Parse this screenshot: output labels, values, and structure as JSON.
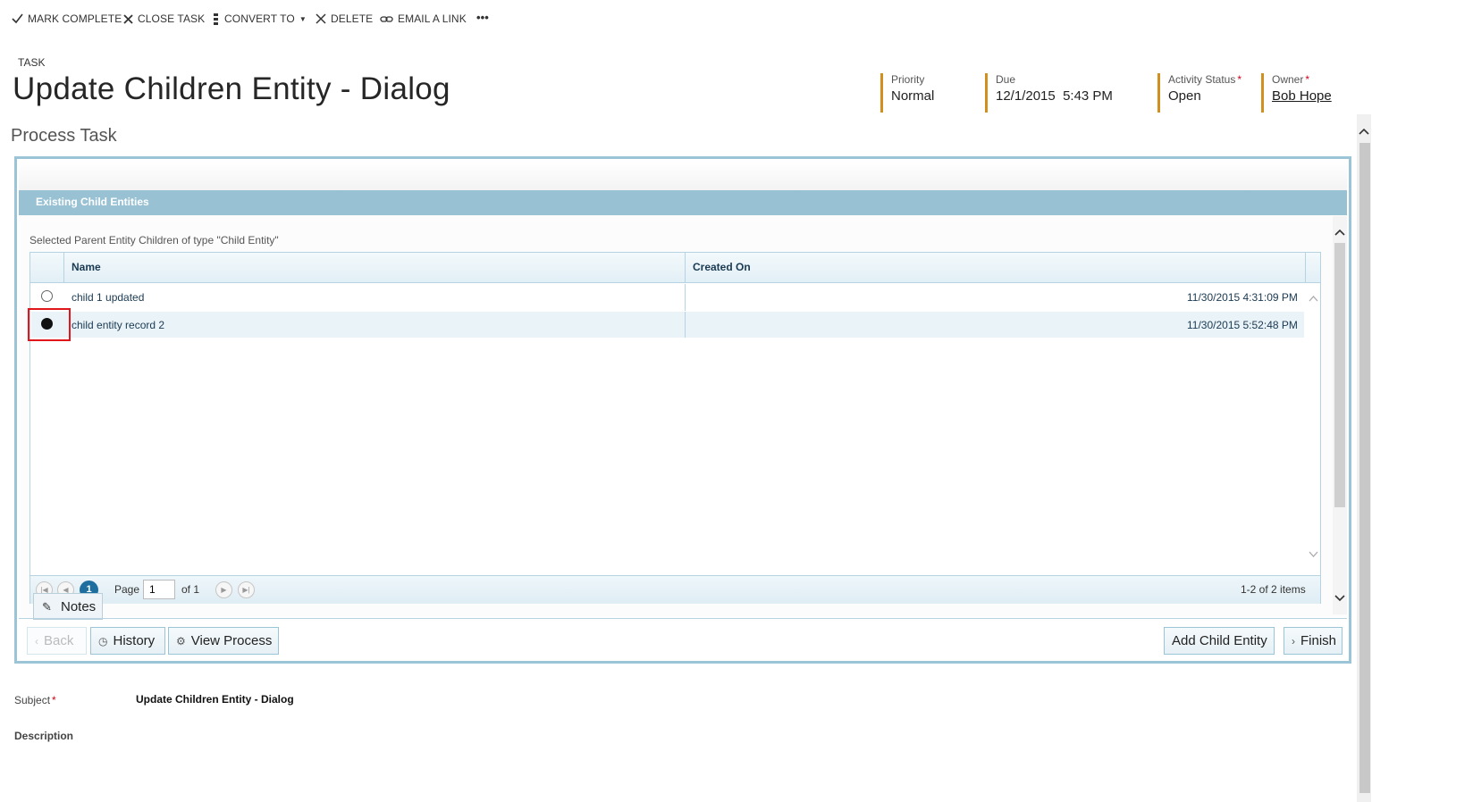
{
  "command_bar": {
    "mark_complete": "MARK COMPLETE",
    "close_task": "CLOSE TASK",
    "convert_to": "CONVERT TO",
    "delete": "DELETE",
    "email_link": "EMAIL A LINK",
    "more": "•••"
  },
  "header": {
    "entity_type": "TASK",
    "title": "Update Children Entity - Dialog",
    "fields": {
      "priority": {
        "label": "Priority",
        "value": "Normal"
      },
      "due": {
        "label": "Due",
        "value": "12/1/2015  5:43 PM"
      },
      "activity_status": {
        "label": "Activity Status",
        "value": "Open",
        "required": "*"
      },
      "owner": {
        "label": "Owner",
        "value": "Bob Hope",
        "required": "*"
      }
    }
  },
  "section_title": "Process Task",
  "dialog": {
    "band_title": "Existing Child Entities",
    "caption": "Selected Parent Entity Children of type \"Child Entity\"",
    "columns": [
      "Name",
      "Created On"
    ],
    "rows": [
      {
        "name": "child 1 updated",
        "created_on": "11/30/2015 4:31:09 PM",
        "selected": false
      },
      {
        "name": "child entity record 2",
        "created_on": "11/30/2015 5:52:48 PM",
        "selected": true
      }
    ],
    "pager": {
      "current_page_badge": "1",
      "page_label": "Page",
      "page_value": "1",
      "of_label": "of 1",
      "items_summary": "1-2 of 2 items"
    },
    "notes_label": "Notes",
    "buttons": {
      "back": "Back",
      "history": "History",
      "view_process": "View Process",
      "add_child_entity": "Add Child Entity",
      "finish": "Finish"
    }
  },
  "form": {
    "subject_label": "Subject",
    "subject_required": "*",
    "subject_value": "Update Children Entity - Dialog",
    "description_label": "Description"
  },
  "colors": {
    "accent": "#d08f1e",
    "frame": "#9bc4d7",
    "band": "#98c1d4",
    "highlight": "#e0161b"
  }
}
